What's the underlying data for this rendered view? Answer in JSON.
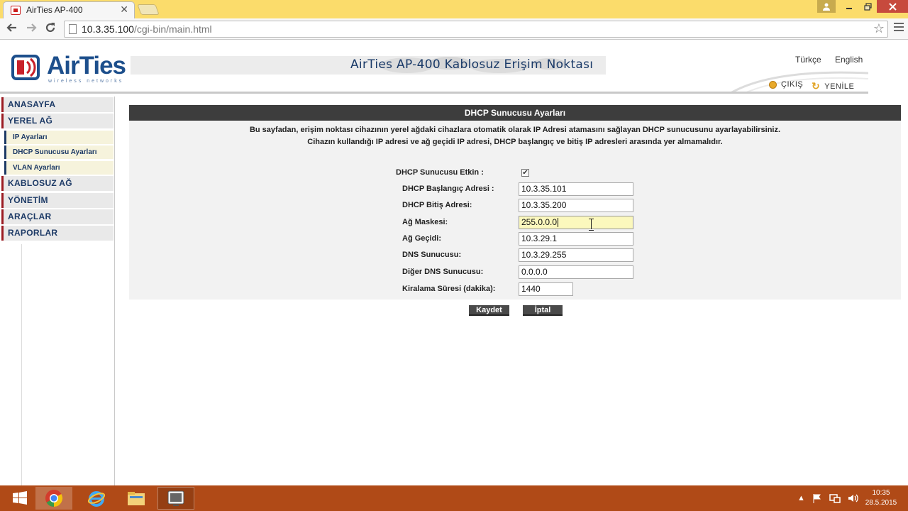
{
  "browser": {
    "tab_title": "AirTies AP-400",
    "url_host": "10.3.35.100",
    "url_path": "/cgi-bin/main.html",
    "close_glyph": "✕"
  },
  "header": {
    "logo_text": "AirTies",
    "logo_sub": "wireless networks",
    "title": "AirTies AP-400  Kablosuz Erişim Noktası",
    "lang_tr": "Türkçe",
    "lang_en": "English",
    "logout": "ÇIKIŞ",
    "refresh": "YENİLE"
  },
  "sidebar": {
    "items": [
      {
        "label": "ANASAYFA"
      },
      {
        "label": "YEREL AĞ"
      },
      {
        "label": "IP Ayarları"
      },
      {
        "label": "DHCP Sunucusu Ayarları"
      },
      {
        "label": "VLAN Ayarları"
      },
      {
        "label": "KABLOSUZ AĞ"
      },
      {
        "label": "YÖNETİM"
      },
      {
        "label": "ARAÇLAR"
      },
      {
        "label": "RAPORLAR"
      }
    ]
  },
  "main": {
    "panel_title": "DHCP Sunucusu Ayarları",
    "desc_line1": "Bu sayfadan, erişim noktası cihazının yerel ağdaki cihazlara otomatik olarak IP Adresi atamasını sağlayan DHCP sunucusunu ayarlayabilirsiniz.",
    "desc_line2": "Cihazın kullandığı IP adresi ve ağ geçidi IP adresi, DHCP başlangıç ve bitiş IP adresleri arasında yer almamalıdır.",
    "dhcp_enabled_label": "DHCP Sunucusu Etkin :",
    "dhcp_enabled": true,
    "check_glyph": "✔",
    "fields": {
      "start_label": "DHCP Başlangıç Adresi :",
      "start_value": "10.3.35.101",
      "end_label": "DHCP Bitiş Adresi:",
      "end_value": "10.3.35.200",
      "mask_label": "Ağ Maskesi:",
      "mask_value": "255.0.0.0",
      "gateway_label": "Ağ Geçidi:",
      "gateway_value": "10.3.29.1",
      "dns_label": "DNS Sunucusu:",
      "dns_value": "10.3.29.255",
      "dns2_label": "Diğer DNS Sunucusu:",
      "dns2_value": "0.0.0.0",
      "lease_label": "Kiralama Süresi (dakika):",
      "lease_value": "1440"
    },
    "save_label": "Kaydet",
    "cancel_label": "İptal"
  },
  "taskbar": {
    "time": "10:35",
    "date": "28.5.2015"
  },
  "colors": {
    "accent_red": "#9b1b22",
    "nav_blue": "#1d3a66",
    "panel_header": "#3d3d3d",
    "taskbar": "#b04a17",
    "chrome_tabstrip": "#fbdc6b"
  }
}
